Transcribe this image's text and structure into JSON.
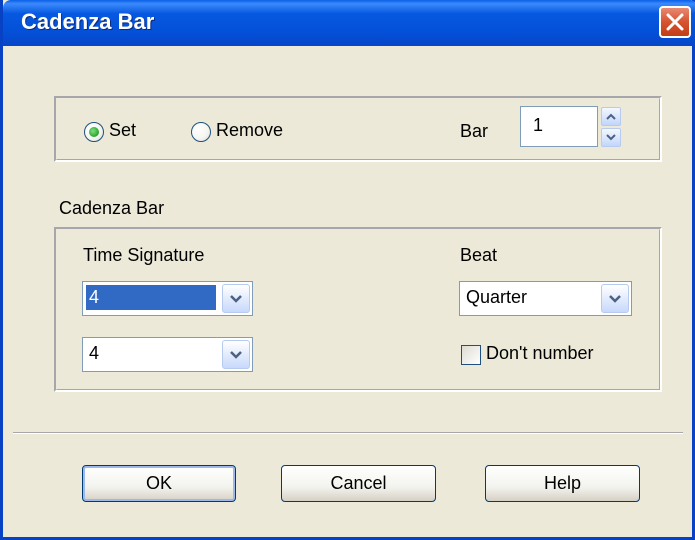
{
  "window": {
    "title": "Cadenza Bar"
  },
  "mode": {
    "set_label": "Set",
    "remove_label": "Remove",
    "selected": "Set"
  },
  "bar": {
    "label": "Bar",
    "value": "1"
  },
  "cadenza": {
    "group_label": "Cadenza Bar",
    "time_signature_label": "Time Signature",
    "numerator": "4",
    "denominator": "4",
    "beat_label": "Beat",
    "beat_value": "Quarter",
    "dont_number_label": "Don't number",
    "dont_number_checked": false
  },
  "buttons": {
    "ok": "OK",
    "cancel": "Cancel",
    "help": "Help"
  },
  "icons": {
    "close": "close-icon",
    "spin_up": "arrow-up-icon",
    "spin_down": "arrow-down-icon",
    "dropdown": "chevron-down-icon"
  }
}
